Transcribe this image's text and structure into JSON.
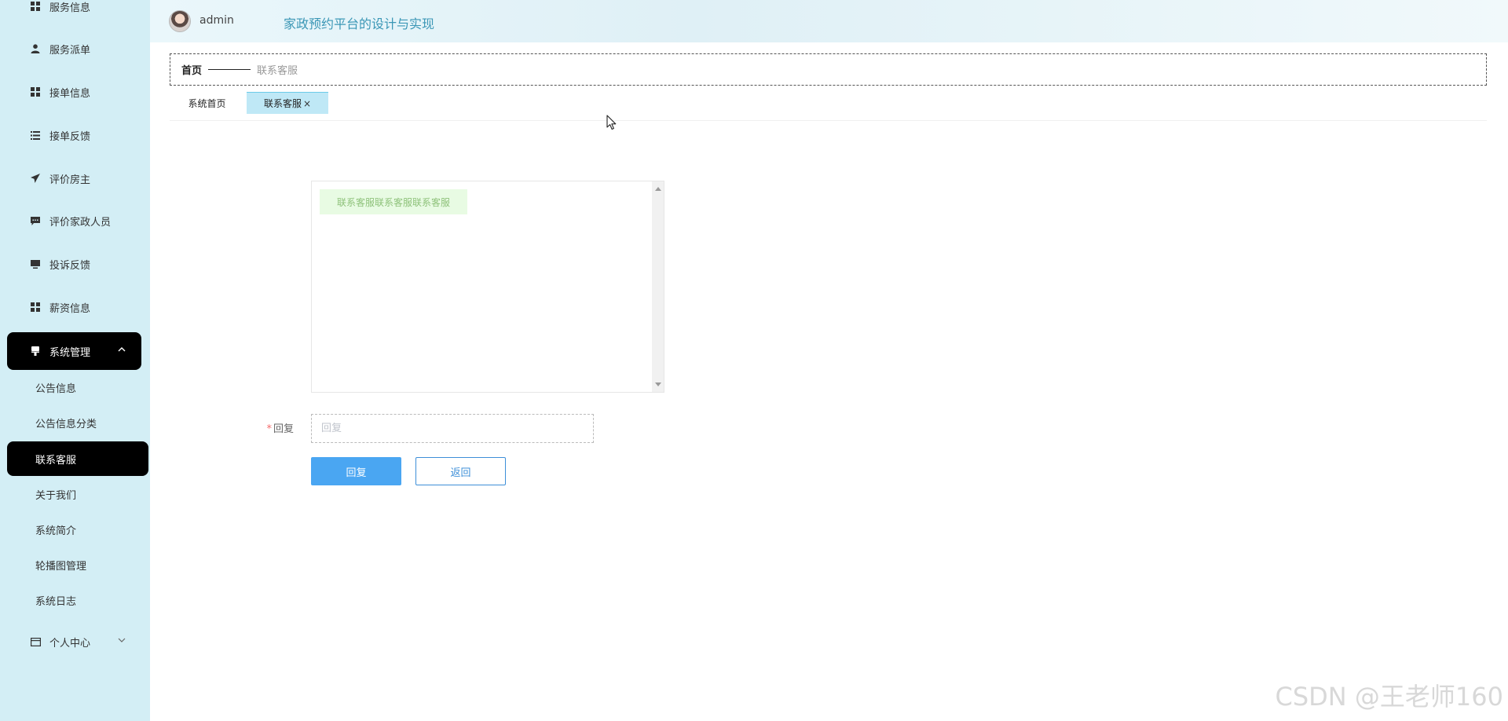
{
  "header": {
    "username": "admin",
    "app_title": "家政预约平台的设计与实现"
  },
  "sidebar": {
    "items": [
      {
        "label": "服务信息",
        "icon": "grid-icon"
      },
      {
        "label": "服务派单",
        "icon": "user-icon"
      },
      {
        "label": "接单信息",
        "icon": "grid-icon"
      },
      {
        "label": "接单反馈",
        "icon": "list-icon"
      },
      {
        "label": "评价房主",
        "icon": "send-icon"
      },
      {
        "label": "评价家政人员",
        "icon": "chat-icon"
      },
      {
        "label": "投诉反馈",
        "icon": "monitor-icon"
      },
      {
        "label": "薪资信息",
        "icon": "grid-icon"
      },
      {
        "label": "系统管理",
        "icon": "brush-icon",
        "expanded": true
      },
      {
        "label": "个人中心",
        "icon": "card-icon",
        "expanded": false
      }
    ],
    "sub_items": [
      "公告信息",
      "公告信息分类",
      "联系客服",
      "关于我们",
      "系统简介",
      "轮播图管理",
      "系统日志"
    ],
    "active_sub": "联系客服"
  },
  "breadcrumb": {
    "home": "首页",
    "current": "联系客服"
  },
  "tabs": [
    {
      "label": "系统首页",
      "active": false
    },
    {
      "label": "联系客服",
      "active": true,
      "close": "×"
    }
  ],
  "chat": {
    "messages": [
      "联系客服联系客服联系客服"
    ]
  },
  "form": {
    "required_mark": "*",
    "reply_label": "回复",
    "reply_placeholder": "回复",
    "reply_value": ""
  },
  "buttons": {
    "reply": "回复",
    "back": "返回"
  },
  "watermark": "CSDN @王老师160",
  "colors": {
    "sidebar_bg": "#d3eef5",
    "active_bg": "#000000",
    "primary": "#4aa6f2",
    "title": "#3b97b6",
    "tab_active": "#bfe8f6",
    "message_bg": "#e8fbe3"
  }
}
